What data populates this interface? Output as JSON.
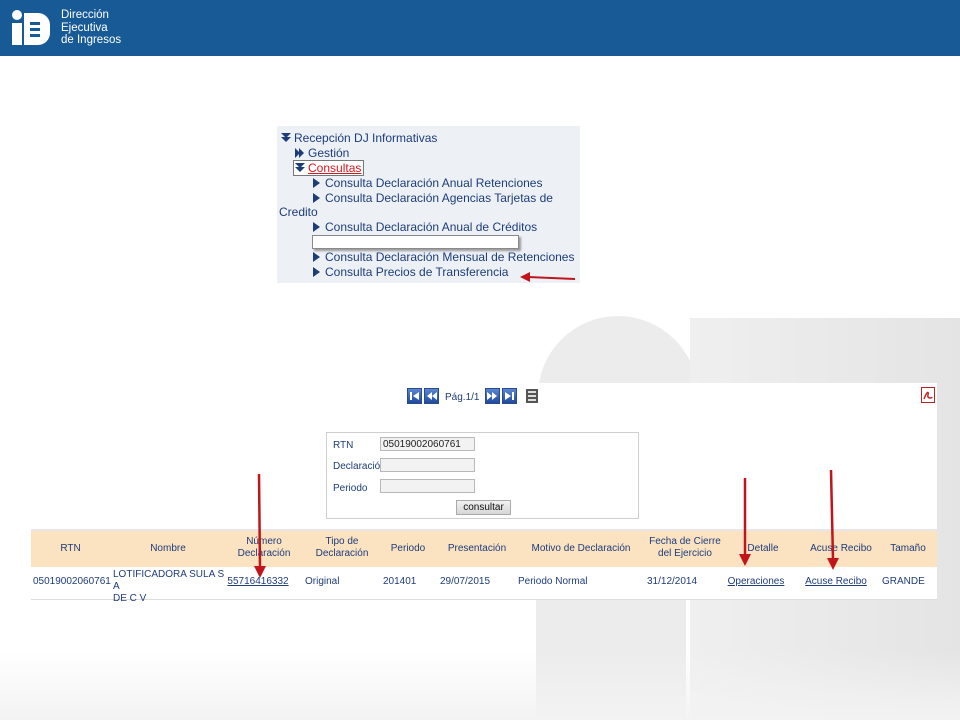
{
  "header": {
    "brand_line1": "Dirección",
    "brand_line2": "Ejecutiva",
    "brand_line3": "de Ingresos",
    "bg_color": "#175a95"
  },
  "menu": {
    "root": "Recepción DJ Informativas",
    "gestion": "Gestión",
    "consultas": "Consultas",
    "items": [
      "Consulta Declaración Anual Retenciones",
      "Consulta Declaración Agencias Tarjetas de",
      "Credito",
      "Consulta Declaración Anual de Créditos",
      "Consulta Declaración Mensual de Retenciones",
      "Consulta Precios de Transferencia"
    ]
  },
  "pager": {
    "label": "Pág.1/1",
    "icons": [
      "first-page-icon",
      "prev-page-icon",
      "next-page-icon",
      "last-page-icon",
      "export-icon"
    ]
  },
  "form": {
    "rtn_label": "RTN",
    "rtn_value": "05019002060761",
    "declaracion_label": "Declaración",
    "declaracion_value": "",
    "periodo_label": "Periodo",
    "periodo_value": "",
    "submit_label": "consultar"
  },
  "table": {
    "headers": {
      "rtn": "RTN",
      "nombre": "Nombre",
      "numero_l1": "Número",
      "numero_l2": "Declaración",
      "tipo_l1": "Tipo de",
      "tipo_l2": "Declaración",
      "periodo": "Periodo",
      "presentacion": "Presentación",
      "motivo": "Motivo de Declaración",
      "fecha_l1": "Fecha de Cierre",
      "fecha_l2": "del Ejercicio",
      "detalle": "Detalle",
      "acuse": "Acuse Recibo",
      "tamano": "Tamaño"
    },
    "row": {
      "rtn": "05019002060761",
      "nombre_l1": "LOTIFICADORA SULA S A",
      "nombre_l2": "DE C V",
      "numero": "55716416332",
      "tipo": "Original",
      "periodo": "201401",
      "presentacion": "29/07/2015",
      "motivo": "Periodo Normal",
      "fecha": "31/12/2014",
      "detalle": "Operaciones",
      "acuse": "Acuse Recibo",
      "tamano": "GRANDE"
    },
    "header_bg": "#fbe3c2"
  },
  "colors": {
    "accent": "#1e3c7a",
    "highlight": "#d6181f",
    "annotation_arrow": "#c0151b"
  }
}
